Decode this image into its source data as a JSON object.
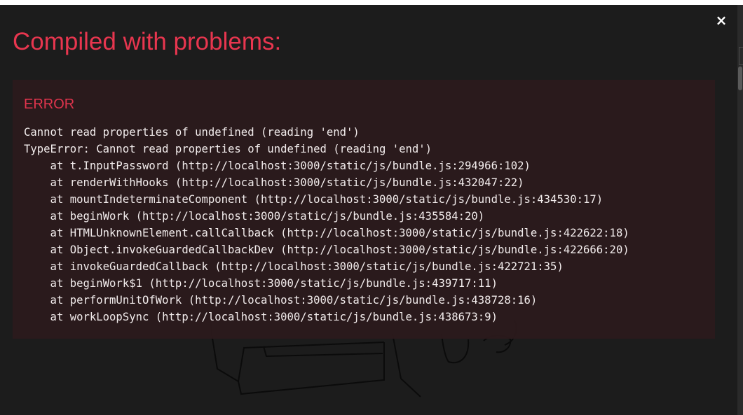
{
  "overlay": {
    "title": "Compiled with problems:",
    "close_label": "×",
    "error": {
      "label": "ERROR",
      "message_lines": [
        "Cannot read properties of undefined (reading 'end')",
        "TypeError: Cannot read properties of undefined (reading 'end')",
        "    at t.InputPassword (http://localhost:3000/static/js/bundle.js:294966:102)",
        "    at renderWithHooks (http://localhost:3000/static/js/bundle.js:432047:22)",
        "    at mountIndeterminateComponent (http://localhost:3000/static/js/bundle.js:434530:17)",
        "    at beginWork (http://localhost:3000/static/js/bundle.js:435584:20)",
        "    at HTMLUnknownElement.callCallback (http://localhost:3000/static/js/bundle.js:422622:18)",
        "    at Object.invokeGuardedCallbackDev (http://localhost:3000/static/js/bundle.js:422666:20)",
        "    at invokeGuardedCallback (http://localhost:3000/static/js/bundle.js:422721:35)",
        "    at beginWork$1 (http://localhost:3000/static/js/bundle.js:439717:11)",
        "    at performUnitOfWork (http://localhost:3000/static/js/bundle.js:438728:16)",
        "    at workLoopSync (http://localhost:3000/static/js/bundle.js:438673:9)"
      ]
    }
  },
  "colors": {
    "overlay_background": "#1c1c1c",
    "error_red": "#e8364f",
    "panel_background": "#2b1a1c",
    "stack_text": "#fbf5f5"
  }
}
